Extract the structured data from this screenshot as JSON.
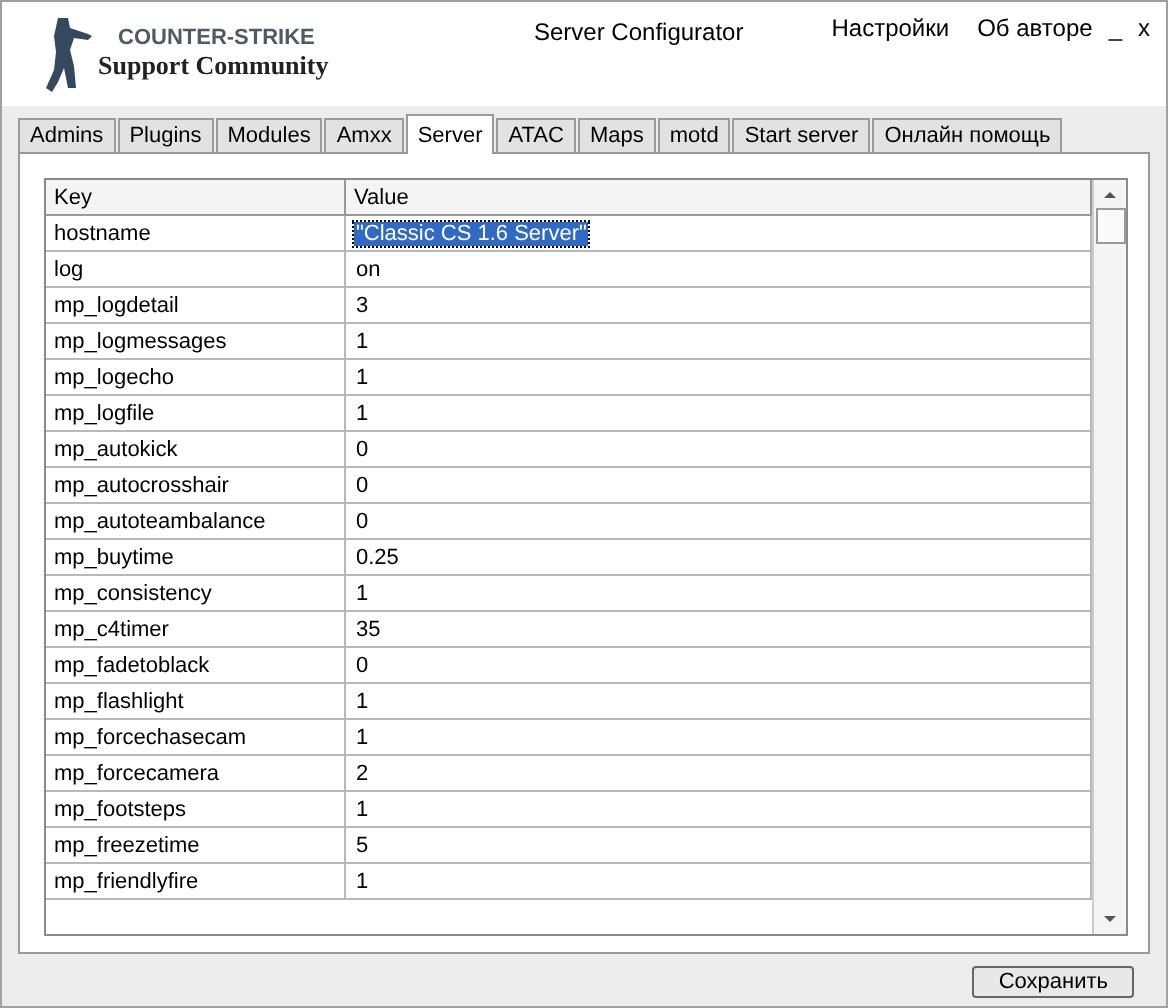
{
  "logo": {
    "line_1": "COUNTER-STRIKE",
    "line_2": "Support Community"
  },
  "window": {
    "title": "Server Configurator"
  },
  "menu": [
    "Настройки",
    "Об авторе"
  ],
  "window_controls": [
    "_",
    "x"
  ],
  "tabs": [
    {
      "label": "Admins",
      "selected": false
    },
    {
      "label": "Plugins",
      "selected": false
    },
    {
      "label": "Modules",
      "selected": false
    },
    {
      "label": "Amxx",
      "selected": false
    },
    {
      "label": "Server",
      "selected": true
    },
    {
      "label": "ATAC",
      "selected": false
    },
    {
      "label": "Maps",
      "selected": false
    },
    {
      "label": "motd",
      "selected": false
    },
    {
      "label": "Start server",
      "selected": false
    },
    {
      "label": "Онлайн помощь",
      "selected": false
    }
  ],
  "table": {
    "columns": [
      "Key",
      "Value"
    ],
    "rows": [
      {
        "key": "hostname",
        "value": "\"Classic CS 1.6 Server\"",
        "selected": true
      },
      {
        "key": "log",
        "value": "on",
        "selected": false
      },
      {
        "key": "mp_logdetail",
        "value": "3",
        "selected": false
      },
      {
        "key": "mp_logmessages",
        "value": "1",
        "selected": false
      },
      {
        "key": "mp_logecho",
        "value": "1",
        "selected": false
      },
      {
        "key": "mp_logfile",
        "value": "1",
        "selected": false
      },
      {
        "key": "mp_autokick",
        "value": "0",
        "selected": false
      },
      {
        "key": "mp_autocrosshair",
        "value": "0",
        "selected": false
      },
      {
        "key": "mp_autoteambalance",
        "value": "0",
        "selected": false
      },
      {
        "key": "mp_buytime",
        "value": "0.25",
        "selected": false
      },
      {
        "key": "mp_consistency",
        "value": "1",
        "selected": false
      },
      {
        "key": "mp_c4timer",
        "value": "35",
        "selected": false
      },
      {
        "key": "mp_fadetoblack",
        "value": "0",
        "selected": false
      },
      {
        "key": "mp_flashlight",
        "value": "1",
        "selected": false
      },
      {
        "key": "mp_forcechasecam",
        "value": "1",
        "selected": false
      },
      {
        "key": "mp_forcecamera",
        "value": "2",
        "selected": false
      },
      {
        "key": "mp_footsteps",
        "value": "1",
        "selected": false
      },
      {
        "key": "mp_freezetime",
        "value": "5",
        "selected": false
      },
      {
        "key": "mp_friendlyfire",
        "value": "1",
        "selected": false
      }
    ]
  },
  "save_button": "Сохранить"
}
